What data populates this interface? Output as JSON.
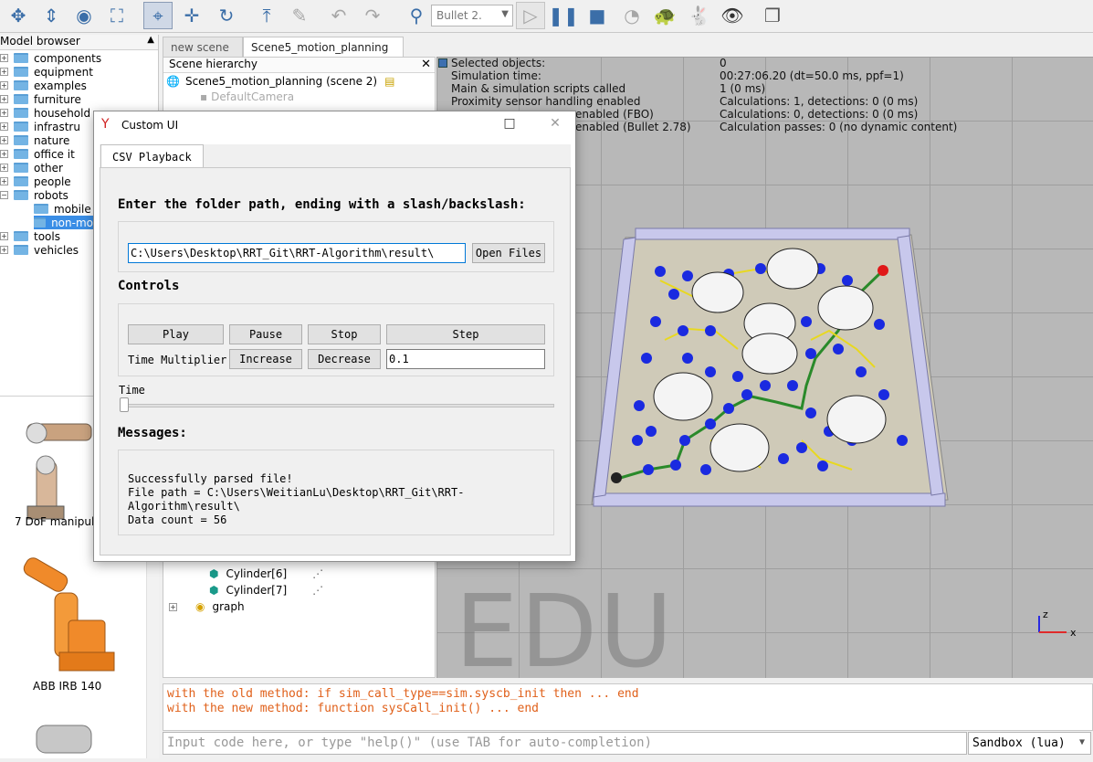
{
  "toolbar": {
    "icons": [
      "pan-icon",
      "translate-view-icon",
      "camera-icon",
      "fit-view-icon",
      "select-icon",
      "move-object-icon",
      "rotate-object-icon",
      "assemble-icon",
      "dynamics-icon",
      "undo-icon",
      "redo-icon",
      "engine-icon",
      "play-icon",
      "pause-icon",
      "stop-icon",
      "realtime-icon",
      "slow-icon",
      "fast-icon",
      "visualization-icon",
      "windows-icon"
    ],
    "engine": "Bullet 2."
  },
  "model_browser": {
    "title": "Model browser",
    "items": [
      {
        "label": "components",
        "expandable": true
      },
      {
        "label": "equipment",
        "expandable": true
      },
      {
        "label": "examples",
        "expandable": true
      },
      {
        "label": "furniture",
        "expandable": true
      },
      {
        "label": "household",
        "expandable": true
      },
      {
        "label": "infrastru",
        "expandable": true
      },
      {
        "label": "nature",
        "expandable": true
      },
      {
        "label": "office it",
        "expandable": true
      },
      {
        "label": "other",
        "expandable": true
      },
      {
        "label": "people",
        "expandable": true
      },
      {
        "label": "robots",
        "expandable": true
      },
      {
        "label": "mobile",
        "expandable": false
      },
      {
        "label": "non-mo",
        "expandable": false
      },
      {
        "label": "tools",
        "expandable": true
      },
      {
        "label": "vehicles",
        "expandable": true
      }
    ],
    "thumbnails": [
      "7 DoF manipul",
      "ABB IRB 140"
    ]
  },
  "scene_tabs": [
    "new scene",
    "Scene5_motion_planning"
  ],
  "hierarchy": {
    "title": "Scene hierarchy",
    "root": "Scene5_motion_planning (scene 2)",
    "camera": "DefaultCamera",
    "items": [
      "Cylinder[6]",
      "Cylinder[7]",
      "graph"
    ]
  },
  "status": {
    "rows": [
      {
        "label": "Selected objects:",
        "value": "0"
      },
      {
        "label": "Simulation time:",
        "value": "00:27:06.20 (dt=50.0 ms, ppf=1)"
      },
      {
        "label": "Main & simulation scripts called",
        "value": "1 (0 ms)"
      },
      {
        "label": "Proximity sensor handling enabled",
        "value": "Calculations: 1, detections: 0 (0 ms)"
      },
      {
        "label": "enabled (FBO)",
        "value": "Calculations: 0, detections: 0 (0 ms)"
      },
      {
        "label": "enabled (Bullet 2.78)",
        "value": "Calculation passes: 0 (no dynamic content)"
      }
    ],
    "watermark": "EDU",
    "axis_x": "x",
    "axis_z": "z"
  },
  "console": {
    "lines": [
      "with the old method: if sim_call_type==sim.syscb_init then ... end",
      "with the new method: function sysCall_init() ... end"
    ],
    "input_placeholder": "Input code here, or type \"help()\" (use TAB for auto-completion)",
    "sandbox": "Sandbox (lua)"
  },
  "custom_ui": {
    "title": "Custom UI",
    "tab": "CSV Playback",
    "folder_prompt": "Enter the folder path, ending with a slash/backslash:",
    "folder_path": "C:\\Users\\Desktop\\RRT_Git\\RRT-Algorithm\\result\\",
    "open_files": "Open Files",
    "controls_title": "Controls",
    "play": "Play",
    "pause": "Pause",
    "stop": "Stop",
    "step": "Step",
    "time_multiplier_label": "Time Multiplier",
    "increase": "Increase",
    "decrease": "Decrease",
    "time_multiplier_value": "0.1",
    "time_label": "Time",
    "time_position": 0.0,
    "messages_title": "Messages:",
    "messages": "Successfully parsed file!\nFile path = C:\\Users\\WeitianLu\\Desktop\\RRT_Git\\RRT-\nAlgorithm\\result\\\nData count = 56"
  }
}
